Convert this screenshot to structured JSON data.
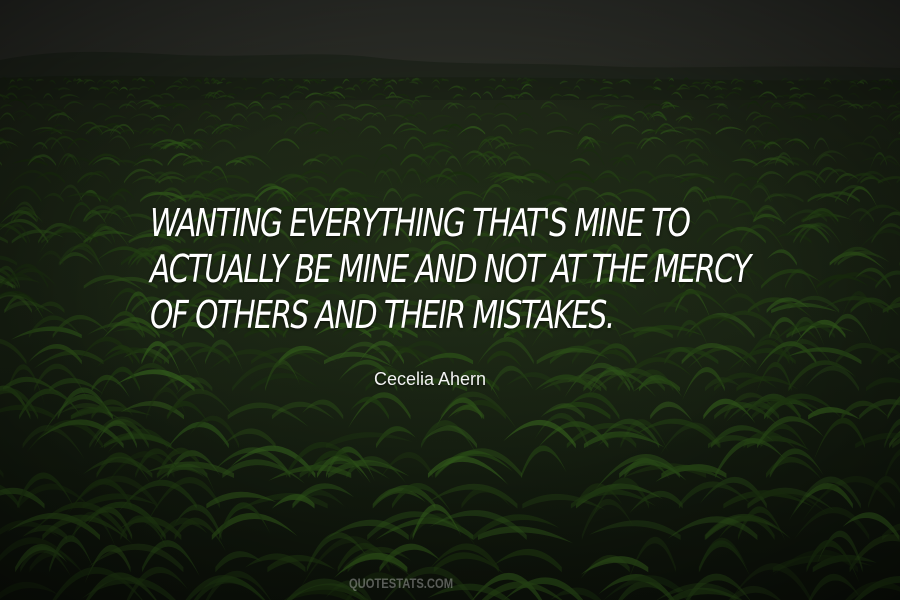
{
  "quote": {
    "lines": [
      "WANTING EVERYTHING THAT'S MINE TO",
      "ACTUALLY BE MINE AND NOT AT THE MERCY",
      "OF OTHERS AND THEIR MISTAKES."
    ]
  },
  "author": "Cecelia Ahern",
  "watermark": "QUOTESTATS.COM",
  "colors": {
    "text": "#ffffff",
    "background_top": "#2e302b",
    "field": "#1a2314"
  }
}
